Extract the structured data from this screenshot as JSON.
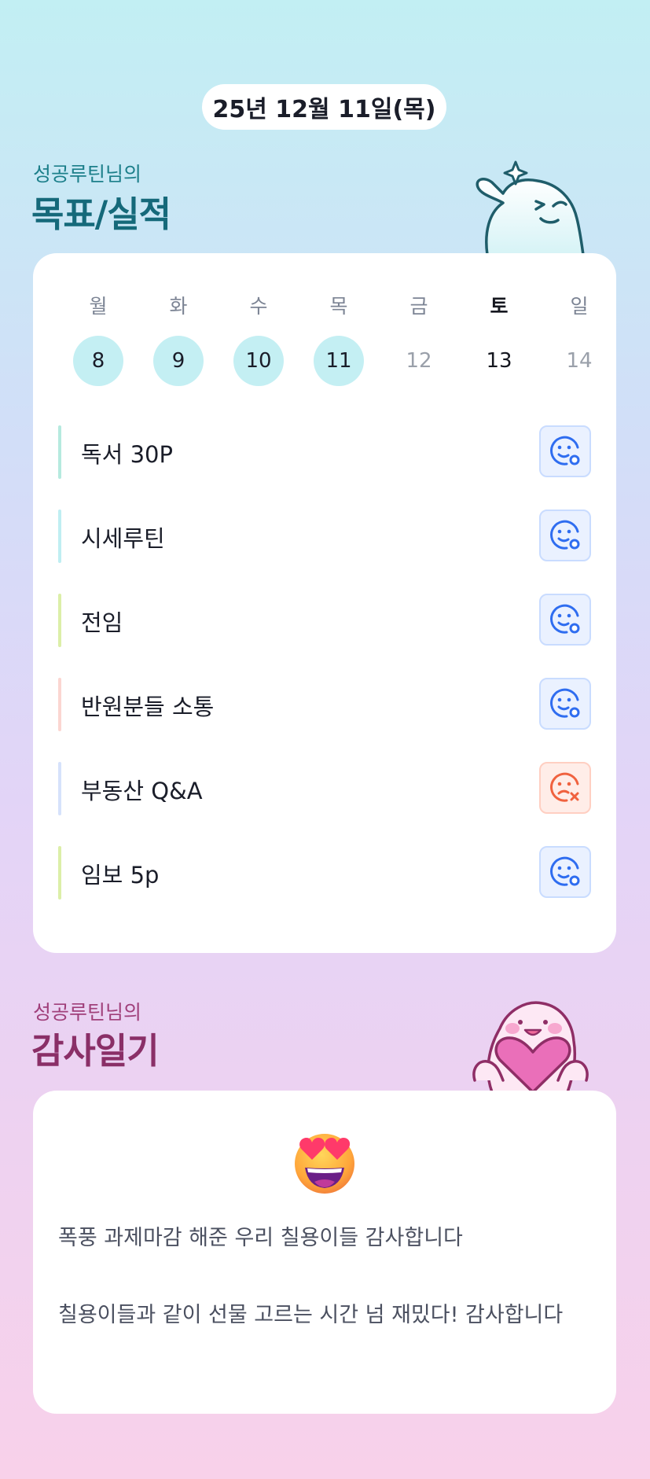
{
  "date_label": "25년 12월 11일(목)",
  "goals_section": {
    "owner_label": "성공루틴님의",
    "title": "목표/실적"
  },
  "week": {
    "days": [
      {
        "day": "월",
        "date": "8",
        "state": "done"
      },
      {
        "day": "화",
        "date": "9",
        "state": "done"
      },
      {
        "day": "수",
        "date": "10",
        "state": "done"
      },
      {
        "day": "목",
        "date": "11",
        "state": "done"
      },
      {
        "day": "금",
        "date": "12",
        "state": "future"
      },
      {
        "day": "토",
        "date": "13",
        "state": "today"
      },
      {
        "day": "일",
        "date": "14",
        "state": "future"
      }
    ]
  },
  "goals": [
    {
      "label": "독서 30P",
      "status": "achieved",
      "status_icon": "smile-check-icon",
      "accent": "#b6eadf"
    },
    {
      "label": "시세루틴",
      "status": "achieved",
      "status_icon": "smile-check-icon",
      "accent": "#bfeef2"
    },
    {
      "label": "전임",
      "status": "achieved",
      "status_icon": "smile-check-icon",
      "accent": "#dcefa8"
    },
    {
      "label": "반원분들 소통",
      "status": "achieved",
      "status_icon": "smile-check-icon",
      "accent": "#fbd6d1"
    },
    {
      "label": "부동산 Q&A",
      "status": "failed",
      "status_icon": "sad-x-icon",
      "accent": "#d6e2fb"
    },
    {
      "label": "임보 5p",
      "status": "achieved",
      "status_icon": "smile-check-icon",
      "accent": "#dcefa8"
    }
  ],
  "gratitude_section": {
    "owner_label": "성공루틴님의",
    "title": "감사일기",
    "emoji": "heart-eyes-emoji",
    "entries": [
      "폭풍 과제마감 해준 우리 칠용이들 감사합니다",
      "칠용이들과 같이 선물 고르는 시간 넘 재밌다! 감사합니다"
    ]
  },
  "colors": {
    "goal_title": "#15697a",
    "gratitude_title": "#8a2f67",
    "done_circle": "#c4eff3",
    "achieved_icon": "#2f6df0",
    "failed_icon": "#f0623f"
  }
}
